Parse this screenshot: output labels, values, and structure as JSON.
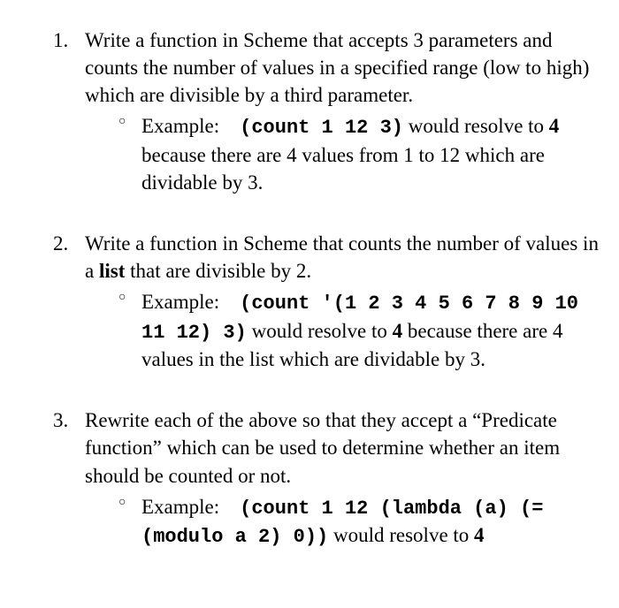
{
  "items": [
    {
      "intro": "Write a function in Scheme that accepts 3 parameters and counts the number of values in a specified range (low to high) which are divisible by a third parameter.",
      "example_label": "Example:",
      "code1": "(count 1 12 3)",
      "mid1": " would resolve to ",
      "bold1": "4",
      "mid2": " because there are 4 values from 1 to 12 which are dividable by 3."
    },
    {
      "intro_a": "Write a function in Scheme that counts the number of values in a ",
      "intro_bold": "list",
      "intro_b": " that are divisible by 2.",
      "example_label": "Example:",
      "code1": "(count '(1 2 3 4 5 6 7 8 9 10 11 12) 3)",
      "mid1": "  would resolve to ",
      "bold1": "4",
      "mid2": " because there are 4 values in the list which are dividable by 3."
    },
    {
      "intro": "Rewrite each of the above so that they accept a “Predicate function” which can be used to determine whether an item should be counted or not.",
      "example_label": "Example:",
      "code1": "(count 1 12 (lambda (a) (= (modulo a 2) 0))",
      "mid1": " would resolve to ",
      "bold1": "4"
    }
  ]
}
